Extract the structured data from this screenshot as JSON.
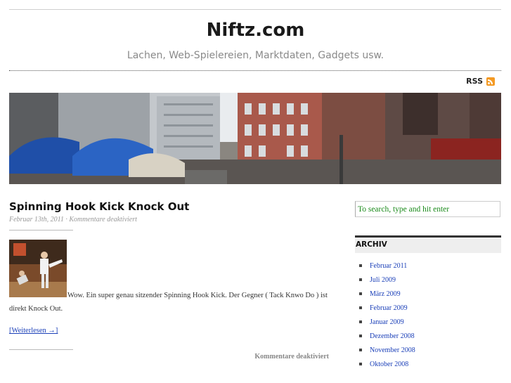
{
  "header": {
    "title": "Niftz.com",
    "tagline": "Lachen, Web-Spielereien, Marktdaten, Gadgets usw.",
    "rss_label": "RSS"
  },
  "post": {
    "title": "Spinning Hook Kick Knock Out",
    "meta": "Februar 13th, 2011 · Kommentare deaktiviert",
    "body": "Wow. Ein super genau sitzender Spinning Hook Kick. Der Gegner ( Tack Knwo Do ) ist direkt Knock Out.",
    "more_link": "[Weiterlesen →]",
    "footer": "Kommentare deaktiviert"
  },
  "sidebar": {
    "search_placeholder": "To search, type and hit enter",
    "archive_heading": "ARCHIV",
    "archive_items": [
      "Februar 2011",
      "Juli 2009",
      "März 2009",
      "Februar 2009",
      "Januar 2009",
      "Dezember 2008",
      "November 2008",
      "Oktober 2008"
    ]
  },
  "colors": {
    "link": "#1a3fb8",
    "search_text": "#1a8a1a",
    "rss_icon": "#f49a24"
  }
}
